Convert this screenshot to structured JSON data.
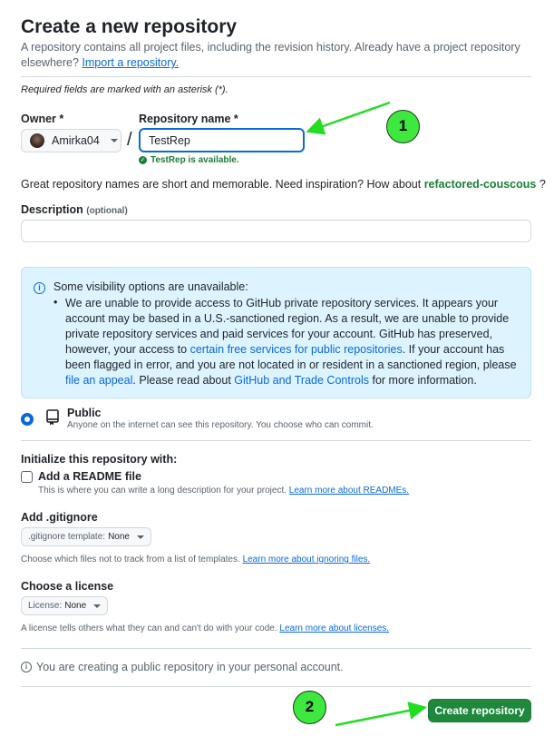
{
  "header": {
    "title": "Create a new repository",
    "subtitle_text": "A repository contains all project files, including the revision history. Already have a project repository elsewhere?",
    "import_link": "Import a repository.",
    "required_note": "Required fields are marked with an asterisk (*)."
  },
  "owner": {
    "label": "Owner *",
    "value": "Amirka04"
  },
  "repo_name": {
    "label": "Repository name *",
    "value": "TestRep",
    "availability": "TestRep is available."
  },
  "suggestion": {
    "text": "Great repository names are short and memorable. Need inspiration? How about",
    "name": "refactored-couscous",
    "suffix": "?"
  },
  "description": {
    "label": "Description",
    "optional": "(optional)",
    "value": ""
  },
  "visibility_notice": {
    "heading": "Some visibility options are unavailable:",
    "body_1": "We are unable to provide access to GitHub private repository services. It appears your account may be based in a U.S.-sanctioned region. As a result, we are unable to provide private repository services and paid services for your account. GitHub has preserved, however, your access to",
    "link_1": "certain free services for public repositories",
    "body_2": ". If your account has been flagged in error, and you are not located in or resident in a sanctioned region, please",
    "link_2": "file an appeal",
    "body_3": ". Please read about",
    "link_3": "GitHub and Trade Controls",
    "body_4": "for more information."
  },
  "visibility": {
    "public_label": "Public",
    "public_desc": "Anyone on the internet can see this repository. You choose who can commit."
  },
  "initialize": {
    "heading": "Initialize this repository with:",
    "readme_label": "Add a README file",
    "readme_checked": false,
    "readme_desc": "This is where you can write a long description for your project.",
    "readme_link": "Learn more about READMEs."
  },
  "gitignore": {
    "label": "Add .gitignore",
    "select_prefix": ".gitignore template:",
    "select_value": "None",
    "desc": "Choose which files not to track from a list of templates.",
    "link": "Learn more about ignoring files."
  },
  "license": {
    "label": "Choose a license",
    "select_prefix": "License:",
    "select_value": "None",
    "desc": "A license tells others what they can and can't do with your code.",
    "link": "Learn more about licenses."
  },
  "footer": {
    "info": "You are creating a public repository in your personal account.",
    "create_label": "Create repository"
  },
  "annotations": {
    "marker_1": "1",
    "marker_2": "2",
    "marker_color": "#3ee83e",
    "arrow_color": "#22dd22"
  },
  "colors": {
    "accent": "#0969da",
    "success": "#1a7f37",
    "button": "#1f883d",
    "notice_bg": "#ddf4ff"
  }
}
